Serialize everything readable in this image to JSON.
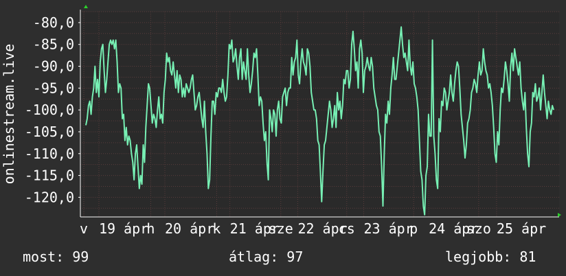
{
  "colors": {
    "background": "#2e2e2e",
    "plot_background": "#2a2a2a",
    "line": "#77f0b4",
    "grid": "#5a3c3c",
    "axis": "#ffffff",
    "axis_arrow": "#2bd02b"
  },
  "stats": {
    "now": "most: 99",
    "avg": "átlag: 97",
    "best": "legjobb: 81"
  },
  "chart_data": {
    "type": "line",
    "ylabel": "onlinestream.live",
    "ylim": [
      -124.5,
      -77.5
    ],
    "xlim": [
      0,
      1
    ],
    "y_ticks": [
      -80,
      -85,
      -90,
      -95,
      -100,
      -105,
      -110,
      -115,
      -120
    ],
    "y_tick_labels": [
      "-80,0",
      "-85,0",
      "-90,0",
      "-95,0",
      "-100,0",
      "-105,0",
      "-110,0",
      "-115,0",
      "-120,0"
    ],
    "x_tick_labels": [
      {
        "x": 0.0,
        "label": "v"
      },
      {
        "x": 0.032,
        "label": "19 ápr"
      },
      {
        "x": 0.142,
        "label": "h"
      },
      {
        "x": 0.172,
        "label": "20 ápr"
      },
      {
        "x": 0.282,
        "label": "k"
      },
      {
        "x": 0.31,
        "label": "21 ápr"
      },
      {
        "x": 0.418,
        "label": "sze"
      },
      {
        "x": 0.454,
        "label": "22 ápr"
      },
      {
        "x": 0.558,
        "label": "cs"
      },
      {
        "x": 0.594,
        "label": "23 ápr"
      },
      {
        "x": 0.7,
        "label": "p"
      },
      {
        "x": 0.732,
        "label": "24 ápr"
      },
      {
        "x": 0.838,
        "label": "szo"
      },
      {
        "x": 0.876,
        "label": "25 ápr"
      }
    ],
    "grid": true,
    "series": [
      {
        "values": [
          -103.5,
          -102,
          -99,
          -98,
          -101,
          -97,
          -95,
          -90,
          -96,
          -93,
          -97,
          -89,
          -86,
          -85,
          -91,
          -96,
          -93,
          -89,
          -85,
          -84,
          -85,
          -84,
          -86,
          -84,
          -89,
          -96,
          -94,
          -95,
          -102,
          -101,
          -107,
          -104,
          -108,
          -106,
          -107,
          -110,
          -112,
          -116,
          -110,
          -108,
          -113,
          -118,
          -115,
          -117,
          -108,
          -112,
          -104,
          -99,
          -94,
          -95,
          -99,
          -103,
          -101,
          -102,
          -104,
          -100,
          -97,
          -102,
          -101,
          -103,
          -96,
          -93,
          -87,
          -89,
          -88,
          -91,
          -92,
          -89,
          -92,
          -95,
          -91,
          -96,
          -92,
          -93,
          -97,
          -95,
          -97,
          -94,
          -95,
          -96,
          -95,
          -93,
          -92,
          -96,
          -100,
          -99,
          -97,
          -96,
          -99,
          -102,
          -104,
          -98,
          -105,
          -110,
          -118,
          -116,
          -106,
          -98,
          -98,
          -101,
          -96,
          -97,
          -95,
          -95,
          -96,
          -93,
          -96,
          -98,
          -97,
          -92,
          -85,
          -86,
          -84,
          -89,
          -88,
          -86,
          -90,
          -93,
          -88,
          -86,
          -93,
          -89,
          -91,
          -93,
          -86,
          -92,
          -96,
          -94,
          -91,
          -87,
          -88,
          -86,
          -92,
          -99,
          -97,
          -98,
          -103,
          -107,
          -105,
          -112,
          -116,
          -100,
          -102,
          -105,
          -100,
          -101,
          -106,
          -100,
          -98,
          -102,
          -103,
          -97,
          -96,
          -95,
          -99,
          -96,
          -95,
          -95,
          -88,
          -92,
          -89,
          -88,
          -84,
          -92,
          -94,
          -89,
          -86,
          -89,
          -90,
          -92,
          -86,
          -87,
          -90,
          -96,
          -98,
          -100,
          -100,
          -102,
          -107,
          -108,
          -114,
          -121,
          -114,
          -108,
          -107,
          -104,
          -101,
          -98,
          -100,
          -104,
          -102,
          -99,
          -104,
          -96,
          -100,
          -98,
          -102,
          -99,
          -93,
          -94,
          -91,
          -91,
          -95,
          -93,
          -85,
          -82,
          -86,
          -91,
          -89,
          -95,
          -86,
          -84,
          -87,
          -96,
          -91,
          -90,
          -88,
          -90,
          -91,
          -88,
          -90,
          -95,
          -97,
          -99,
          -100,
          -105,
          -106,
          -113,
          -122,
          -110,
          -101,
          -103,
          -98,
          -101,
          -95,
          -92,
          -88,
          -93,
          -93,
          -90,
          -87,
          -84,
          -81,
          -85,
          -88,
          -87,
          -89,
          -91,
          -84,
          -90,
          -92,
          -89,
          -94,
          -95,
          -97,
          -100,
          -107,
          -114,
          -116,
          -122,
          -124,
          -115,
          -113,
          -101,
          -106,
          -106,
          -84,
          -106,
          -110,
          -116,
          -118,
          -102,
          -105,
          -98,
          -99,
          -95,
          -96,
          -100,
          -98,
          -96,
          -92,
          -96,
          -98,
          -94,
          -91,
          -89,
          -90,
          -95,
          -101,
          -104,
          -107,
          -111,
          -108,
          -103,
          -102,
          -100,
          -96,
          -95,
          -93,
          -94,
          -96,
          -92,
          -89,
          -92,
          -91,
          -86,
          -89,
          -91,
          -92,
          -95,
          -94,
          -96,
          -99,
          -104,
          -110,
          -112,
          -105,
          -108,
          -100,
          -95,
          -96,
          -93,
          -89,
          -91,
          -94,
          -98,
          -90,
          -87,
          -91,
          -86,
          -88,
          -90,
          -92,
          -89,
          -95,
          -98,
          -100,
          -96,
          -104,
          -110,
          -113,
          -105,
          -103,
          -96,
          -97,
          -94,
          -98,
          -97,
          -95,
          -100,
          -96,
          -92,
          -96,
          -99,
          -102,
          -98,
          -100,
          -101,
          -99,
          -100
        ]
      }
    ]
  }
}
